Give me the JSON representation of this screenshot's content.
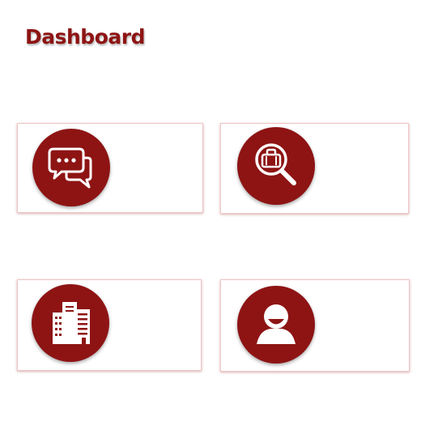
{
  "header": {
    "title": "Dashboard"
  },
  "theme": {
    "accent": "#8e1414",
    "card_border": "#f0c6c6",
    "background": "#ffffff"
  },
  "cards": [
    {
      "icon": "chat-bubbles-icon"
    },
    {
      "icon": "search-briefcase-icon"
    },
    {
      "icon": "office-building-icon"
    },
    {
      "icon": "user-avatar-icon"
    }
  ]
}
